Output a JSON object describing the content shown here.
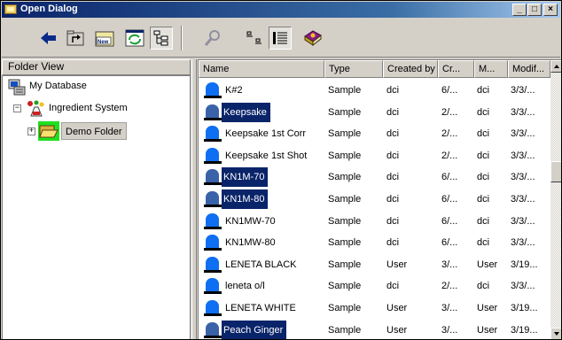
{
  "window": {
    "title": "Open Dialog",
    "controls": {
      "minimize": "_",
      "maximize": "□",
      "close": "×"
    }
  },
  "toolbar": {
    "buttons": [
      {
        "name": "back-button",
        "icon": "left-arrow-icon"
      },
      {
        "name": "up-folder-button",
        "icon": "up-folder-icon"
      },
      {
        "name": "new-folder-button",
        "icon": "new-folder-icon",
        "label": "New"
      },
      {
        "name": "refresh-button",
        "icon": "refresh-window-icon"
      },
      {
        "name": "tree-view-button",
        "icon": "tree-view-icon"
      },
      {
        "name": "search-button",
        "icon": "magnifier-icon"
      },
      {
        "name": "small-icons-button",
        "icon": "small-icons-icon"
      },
      {
        "name": "details-view-button",
        "icon": "details-view-icon"
      },
      {
        "name": "help-book-button",
        "icon": "help-book-icon"
      }
    ]
  },
  "folder_view": {
    "header": "Folder View",
    "tree": [
      {
        "label": "My Database",
        "icon": "database-icon",
        "level": 0
      },
      {
        "label": "Ingredient System",
        "icon": "ingredient-system-icon",
        "level": 1,
        "expander": "−"
      },
      {
        "label": "Demo Folder",
        "icon": "open-folder-icon",
        "level": 2,
        "expander": "+",
        "selected": true
      }
    ]
  },
  "file_list": {
    "columns": [
      "Name",
      "Type",
      "Created by",
      "Cr...",
      "M...",
      "Modif..."
    ],
    "rows": [
      {
        "name": "K#2",
        "type": "Sample",
        "created_by": "dci",
        "created": "6/...",
        "modified_by": "dci",
        "modified": "3/3/...",
        "selected": false
      },
      {
        "name": "Keepsake",
        "type": "Sample",
        "created_by": "dci",
        "created": "2/...",
        "modified_by": "dci",
        "modified": "3/3/...",
        "selected": true
      },
      {
        "name": "Keepsake 1st Corr",
        "type": "Sample",
        "created_by": "dci",
        "created": "2/...",
        "modified_by": "dci",
        "modified": "3/3/...",
        "selected": false
      },
      {
        "name": "Keepsake 1st Shot",
        "type": "Sample",
        "created_by": "dci",
        "created": "2/...",
        "modified_by": "dci",
        "modified": "3/3/...",
        "selected": false
      },
      {
        "name": "KN1M-70",
        "type": "Sample",
        "created_by": "dci",
        "created": "6/...",
        "modified_by": "dci",
        "modified": "3/3/...",
        "selected": true
      },
      {
        "name": "KN1M-80",
        "type": "Sample",
        "created_by": "dci",
        "created": "6/...",
        "modified_by": "dci",
        "modified": "3/3/...",
        "selected": true
      },
      {
        "name": "KN1MW-70",
        "type": "Sample",
        "created_by": "dci",
        "created": "6/...",
        "modified_by": "dci",
        "modified": "3/3/...",
        "selected": false
      },
      {
        "name": "KN1MW-80",
        "type": "Sample",
        "created_by": "dci",
        "created": "6/...",
        "modified_by": "dci",
        "modified": "3/3/...",
        "selected": false
      },
      {
        "name": "LENETA BLACK",
        "type": "Sample",
        "created_by": "User",
        "created": "3/...",
        "modified_by": "User",
        "modified": "3/19...",
        "selected": false
      },
      {
        "name": "leneta o/l",
        "type": "Sample",
        "created_by": "dci",
        "created": "2/...",
        "modified_by": "dci",
        "modified": "3/3/...",
        "selected": false
      },
      {
        "name": "LENETA WHITE",
        "type": "Sample",
        "created_by": "User",
        "created": "3/...",
        "modified_by": "User",
        "modified": "3/19...",
        "selected": false
      },
      {
        "name": "Peach Ginger",
        "type": "Sample",
        "created_by": "User",
        "created": "3/...",
        "modified_by": "User",
        "modified": "3/19...",
        "selected": true
      }
    ]
  },
  "colors": {
    "selection": "#0a246a",
    "sample_icon": "#0f6ff2",
    "face": "#d4d0c8"
  }
}
